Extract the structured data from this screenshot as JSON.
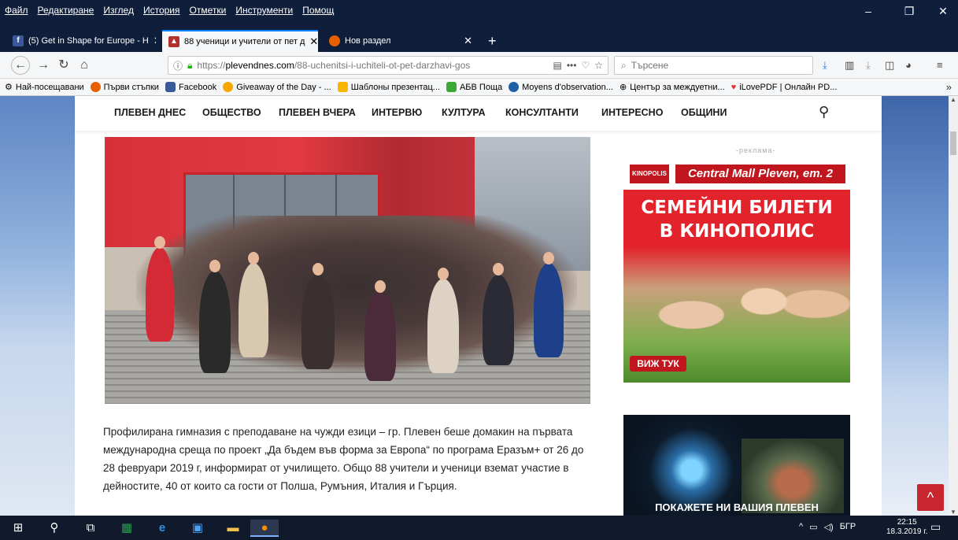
{
  "menu": {
    "items": [
      "Файл",
      "Редактиране",
      "Изглед",
      "История",
      "Отметки",
      "Инструменти",
      "Помощ"
    ]
  },
  "window_controls": {
    "minimize": "–",
    "restore": "❐",
    "close": "✕"
  },
  "tabs": [
    {
      "title": "(5) Get in Shape for Europe - Н",
      "active": false
    },
    {
      "title": "88 ученици и учители от пет д",
      "active": true
    },
    {
      "title": "Нов раздел",
      "active": false
    }
  ],
  "new_tab_label": "+",
  "navbar": {
    "url_prefix": "https://",
    "url_domain": "plevendnes.com",
    "url_path": "/88-uchenitsi-i-uchiteli-ot-pet-darzhavi-gos",
    "page_actions": "•••",
    "search_placeholder": "Търсене"
  },
  "bookmarks": [
    {
      "label": "Най-посещавани",
      "color": "#777777"
    },
    {
      "label": "Първи стъпки",
      "color": "#e66000"
    },
    {
      "label": "Facebook",
      "color": "#3b5998"
    },
    {
      "label": "Giveaway of the Day - ...",
      "color": "#f6a800"
    },
    {
      "label": "Шаблоны презентац...",
      "color": "#f7b500"
    },
    {
      "label": "АБВ Поща",
      "color": "#3aa935"
    },
    {
      "label": "Moyens d'observation...",
      "color": "#1f5fa6"
    },
    {
      "label": "Център за междуетни...",
      "color": "#444444"
    },
    {
      "label": "iLovePDF | Онлайн PD...",
      "color": "#e5322d"
    }
  ],
  "bookmarks_overflow": "»",
  "site_nav": {
    "items": [
      "ПЛЕВЕН ДНЕС",
      "ОБЩЕСТВО",
      "ПЛЕВЕН ВЧЕРА",
      "ИНТЕРВЮ",
      "КУЛТУРА",
      "КОНСУЛТАНТИ",
      "ИНТЕРЕСНО",
      "ОБЩИНИ"
    ]
  },
  "article": {
    "paragraph": "Профилирана гимназия с преподаване на чужди езици – гр. Плевен беше домакин на първата международна среща по проект „Да бъдем във форма за Европа“ по програма Еразъм+ от 26 до 28 февруари 2019 г, информират от училището. Общо 88 учители и ученици вземат участие в дейностите, 40 от които са гости от Полша, Румъния, Италия и Гърция."
  },
  "ads": {
    "label": "-реклама-",
    "kinopolis": {
      "logo": "KINOPOLIS",
      "location": "Central Mall Pleven, ет. 2",
      "headline_line1": "СЕМЕЙНИ БИЛЕТИ",
      "headline_line2": "В КИНОПОЛИС",
      "cta": "ВИЖ ТУК"
    },
    "second": {
      "cta": "ПОКАЖЕТЕ НИ ВАШИЯ ПЛЕВЕН"
    }
  },
  "back_to_top": "^",
  "taskbar": {
    "language": "БГР",
    "time": "22:15",
    "date": "18.3.2019 г."
  },
  "colors": {
    "accent": "#0a84ff",
    "site_red": "#c7262f",
    "titlebar": "#0f1e3a"
  }
}
